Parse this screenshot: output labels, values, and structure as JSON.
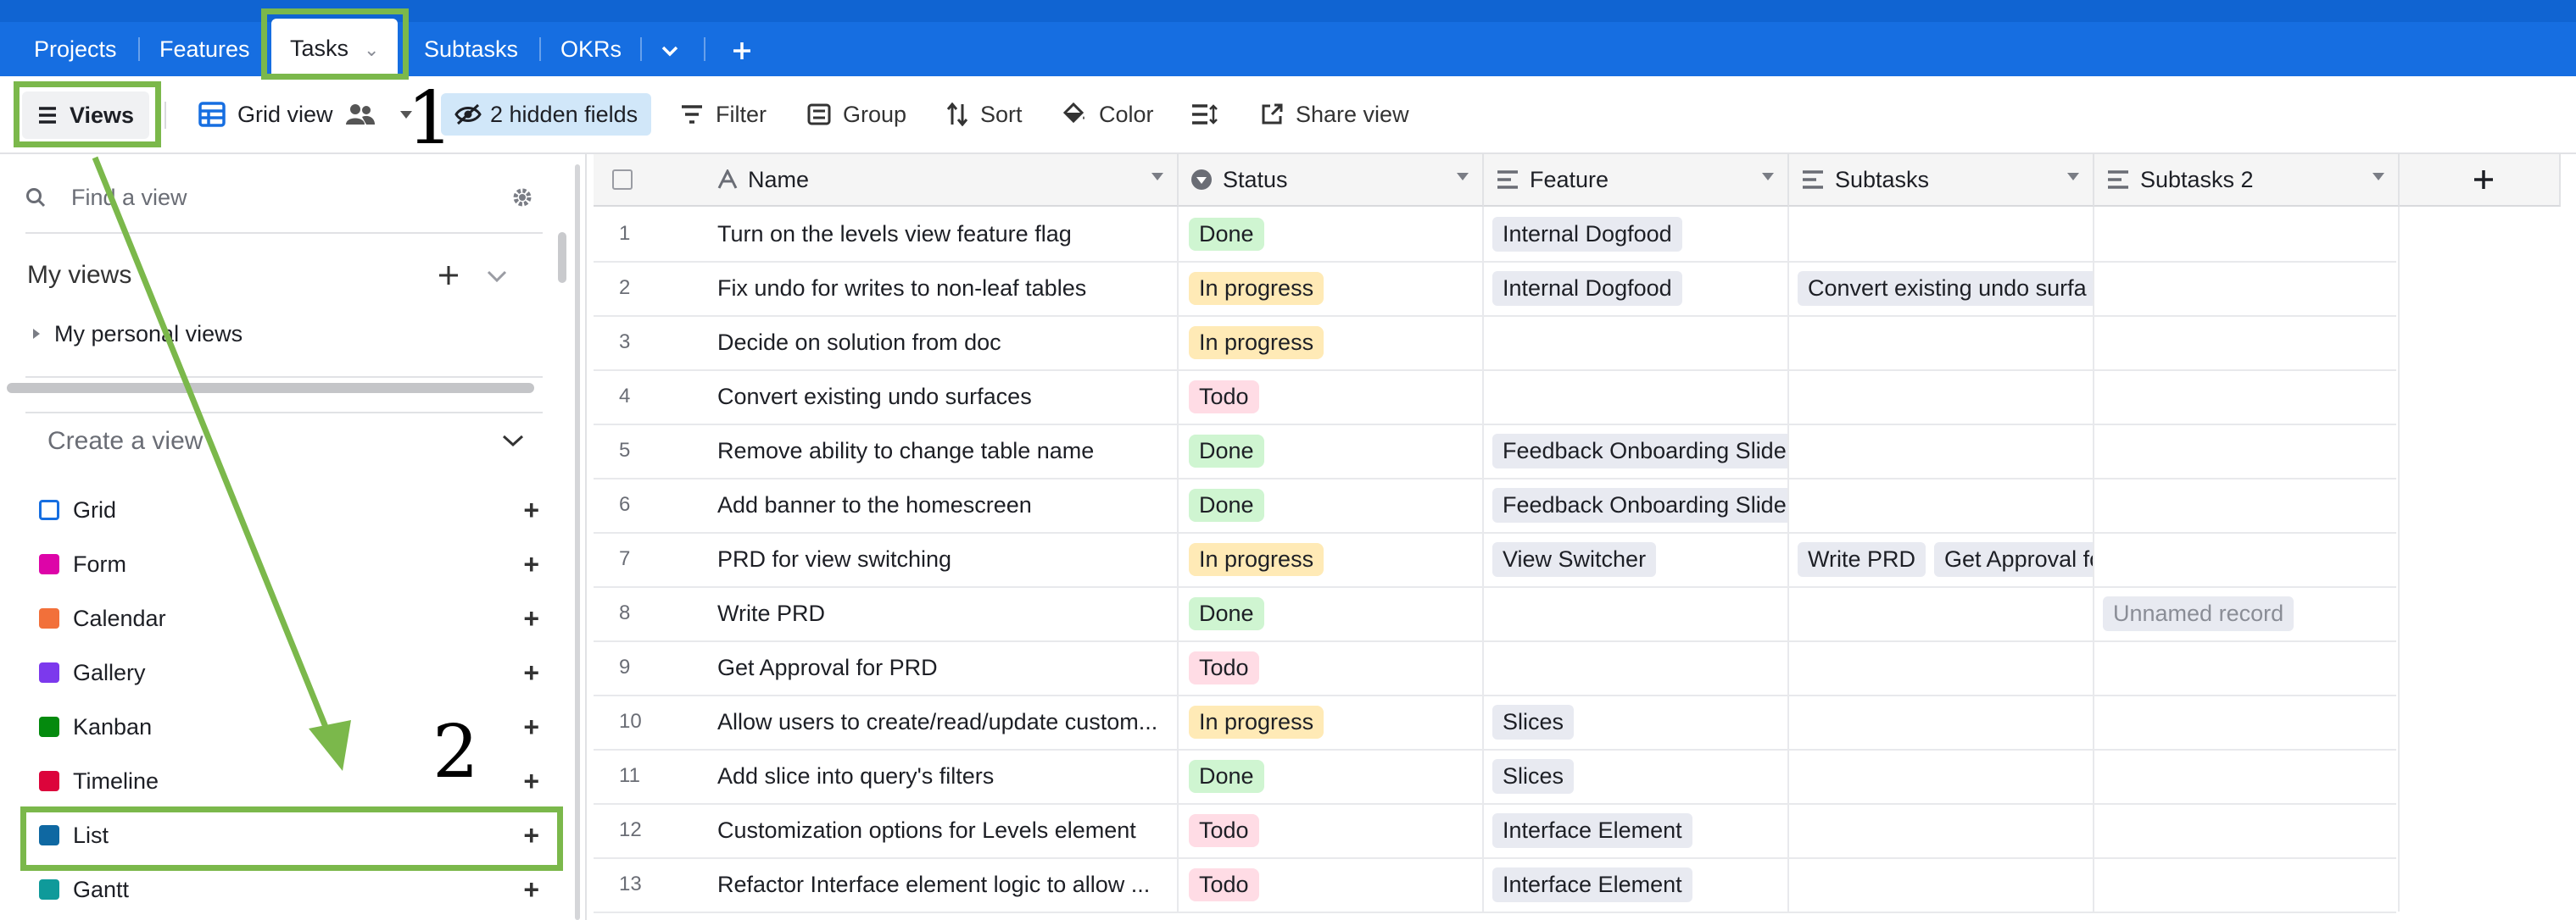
{
  "tabs": [
    {
      "label": "Projects"
    },
    {
      "label": "Features"
    },
    {
      "label": "Tasks"
    },
    {
      "label": "Subtasks"
    },
    {
      "label": "OKRs"
    }
  ],
  "toolbar": {
    "views": "Views",
    "view_name": "Grid view",
    "hidden_fields": "2 hidden fields",
    "filter": "Filter",
    "group": "Group",
    "sort": "Sort",
    "color": "Color",
    "share": "Share view"
  },
  "sidebar": {
    "find_placeholder": "Find a view",
    "my_views": "My views",
    "my_personal_views": "My personal views",
    "create_view": "Create a view",
    "view_types": [
      {
        "label": "Grid",
        "color": "#166ee1"
      },
      {
        "label": "Form",
        "color": "#dd04a8"
      },
      {
        "label": "Calendar",
        "color": "#f2703a"
      },
      {
        "label": "Gallery",
        "color": "#7c39ed"
      },
      {
        "label": "Kanban",
        "color": "#048a0e"
      },
      {
        "label": "Timeline",
        "color": "#dc043b"
      },
      {
        "label": "List",
        "color": "#0f68a2"
      },
      {
        "label": "Gantt",
        "color": "#0f9a9a"
      }
    ]
  },
  "grid": {
    "columns": [
      "Name",
      "Status",
      "Feature",
      "Subtasks",
      "Subtasks 2"
    ],
    "rows": [
      {
        "num": "1",
        "name": "Turn on the levels view feature flag",
        "status": "Done",
        "feature": [
          "Internal Dogfood"
        ],
        "subtasks": [],
        "subtasks2": []
      },
      {
        "num": "2",
        "name": "Fix undo for writes to non-leaf tables",
        "status": "In progress",
        "feature": [
          "Internal Dogfood"
        ],
        "subtasks": [
          "Convert existing undo surfa"
        ],
        "subtasks2": []
      },
      {
        "num": "3",
        "name": "Decide on solution from doc",
        "status": "In progress",
        "feature": [],
        "subtasks": [],
        "subtasks2": []
      },
      {
        "num": "4",
        "name": "Convert existing undo surfaces",
        "status": "Todo",
        "feature": [],
        "subtasks": [],
        "subtasks2": []
      },
      {
        "num": "5",
        "name": "Remove ability to change table name",
        "status": "Done",
        "feature": [
          "Feedback Onboarding Slide"
        ],
        "subtasks": [],
        "subtasks2": []
      },
      {
        "num": "6",
        "name": "Add banner to the homescreen",
        "status": "Done",
        "feature": [
          "Feedback Onboarding Slide"
        ],
        "subtasks": [],
        "subtasks2": []
      },
      {
        "num": "7",
        "name": "PRD for view switching",
        "status": "In progress",
        "feature": [
          "View Switcher"
        ],
        "subtasks": [
          "Write PRD",
          "Get Approval for"
        ],
        "subtasks2": []
      },
      {
        "num": "8",
        "name": "Write PRD",
        "status": "Done",
        "feature": [],
        "subtasks": [],
        "subtasks2": [
          "Unnamed record"
        ]
      },
      {
        "num": "9",
        "name": "Get Approval for PRD",
        "status": "Todo",
        "feature": [],
        "subtasks": [],
        "subtasks2": []
      },
      {
        "num": "10",
        "name": "Allow users to create/read/update custom...",
        "status": "In progress",
        "feature": [
          "Slices"
        ],
        "subtasks": [],
        "subtasks2": []
      },
      {
        "num": "11",
        "name": "Add slice into query's filters",
        "status": "Done",
        "feature": [
          "Slices"
        ],
        "subtasks": [],
        "subtasks2": []
      },
      {
        "num": "12",
        "name": "Customization options for Levels element",
        "status": "Todo",
        "feature": [
          "Interface Element"
        ],
        "subtasks": [],
        "subtasks2": []
      },
      {
        "num": "13",
        "name": "Refactor Interface element logic to allow ...",
        "status": "Todo",
        "feature": [
          "Interface Element"
        ],
        "subtasks": [],
        "subtasks2": []
      }
    ]
  },
  "status_colors": {
    "Done": "#cff5d1",
    "In progress": "#ffeab6",
    "Todo": "#ffdce5"
  },
  "annotations": {
    "step1": "1",
    "step2": "2",
    "color": "#7bb84b"
  }
}
